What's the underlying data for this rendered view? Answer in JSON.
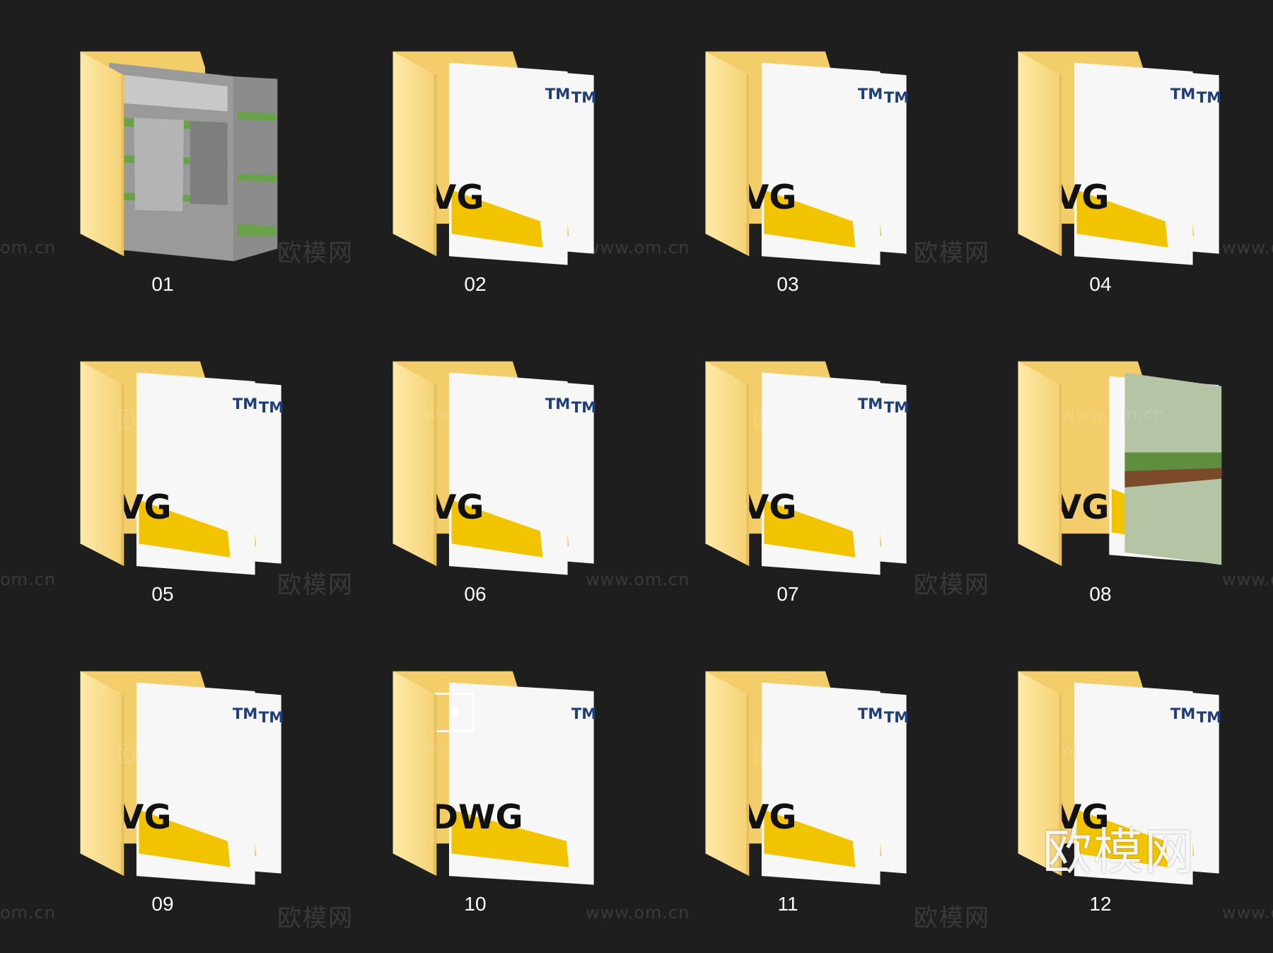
{
  "folders": [
    {
      "name": "01",
      "preview": "render"
    },
    {
      "name": "02",
      "preview": "dwg"
    },
    {
      "name": "03",
      "preview": "dwg"
    },
    {
      "name": "04",
      "preview": "dwg"
    },
    {
      "name": "05",
      "preview": "dwg"
    },
    {
      "name": "06",
      "preview": "dwg"
    },
    {
      "name": "07",
      "preview": "dwg"
    },
    {
      "name": "08",
      "preview": "dwg-sketch"
    },
    {
      "name": "09",
      "preview": "dwg"
    },
    {
      "name": "10",
      "preview": "dwg-full"
    },
    {
      "name": "11",
      "preview": "dwg"
    },
    {
      "name": "12",
      "preview": "dwg"
    }
  ],
  "icon_text": {
    "dwg": "VG",
    "dwg_full": "DWG",
    "tm": "TM"
  },
  "watermarks": {
    "cn": "欧模网",
    "url": "www.om.cn",
    "url_short": "om.cn",
    "big": "欧模网"
  },
  "colors": {
    "background": "#1e1e1e",
    "folder_back": "#f3cd6a",
    "folder_front": "#fbe49a",
    "dwg_blue": "#2a4a82",
    "dwg_yellow": "#f2c400",
    "label": "#ffffff"
  }
}
